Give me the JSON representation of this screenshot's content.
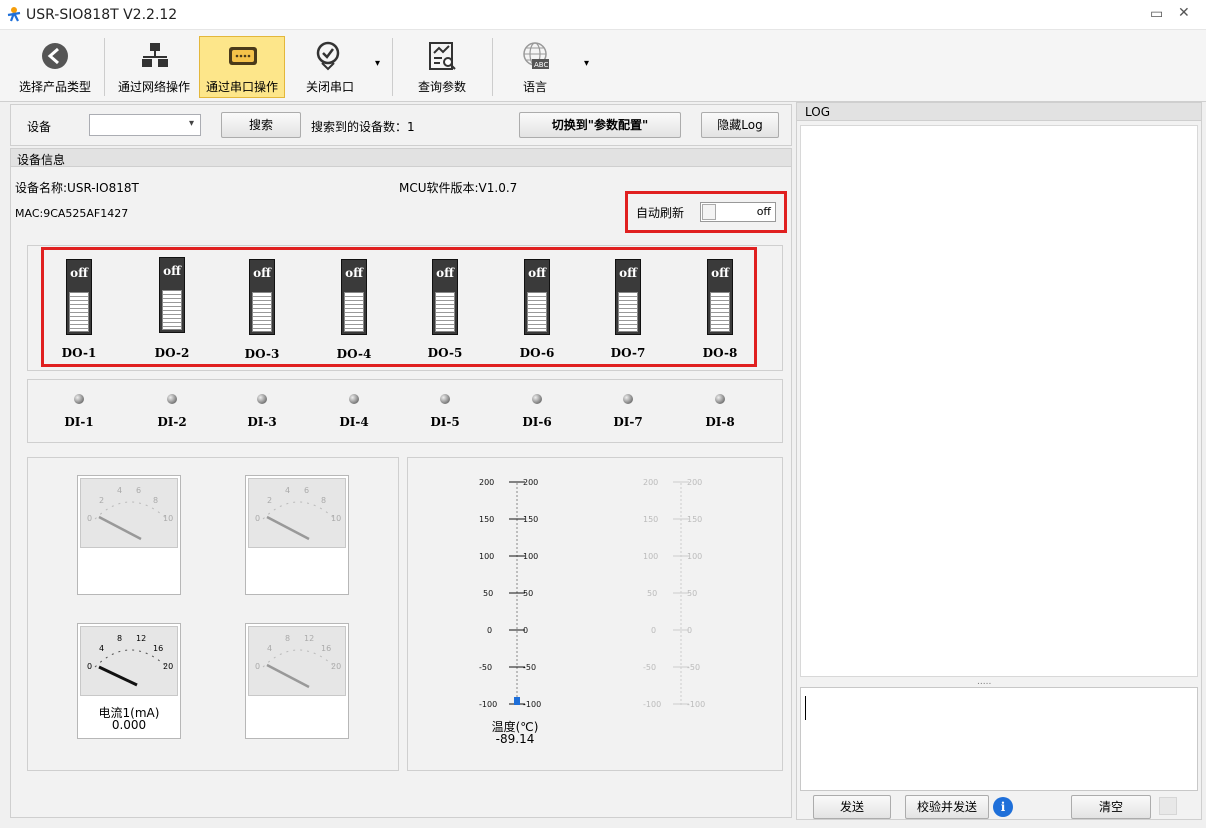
{
  "window": {
    "title": "USR-SIO818T V2.2.12"
  },
  "toolbar": {
    "items": [
      {
        "label": "选择产品类型",
        "icon": "back-arrow-icon"
      },
      {
        "label": "通过网络操作",
        "icon": "network-icon"
      },
      {
        "label": "通过串口操作",
        "icon": "serial-port-icon"
      },
      {
        "label": "关闭串口",
        "icon": "check-pin-icon"
      },
      {
        "label": "查询参数",
        "icon": "query-chart-icon"
      },
      {
        "label": "语言",
        "icon": "globe-abc-icon"
      }
    ]
  },
  "device_bar": {
    "device_label": "设备",
    "device_value": "",
    "search_label": "搜索",
    "found_label": "搜索到的设备数：1",
    "switch_config_label": "切换到\"参数配置\"",
    "hide_log_label": "隐藏Log"
  },
  "device_info": {
    "header": "设备信息",
    "name": "设备名称:USR-IO818T",
    "mcu": "MCU软件版本:V1.0.7",
    "mac": "MAC:9CA525AF1427",
    "auto_refresh_label": "自动刷新",
    "auto_refresh_state": "off"
  },
  "do_switches": [
    {
      "label": "DO-1",
      "state": "off"
    },
    {
      "label": "DO-2",
      "state": "off"
    },
    {
      "label": "DO-3",
      "state": "off"
    },
    {
      "label": "DO-4",
      "state": "off"
    },
    {
      "label": "DO-5",
      "state": "off"
    },
    {
      "label": "DO-6",
      "state": "off"
    },
    {
      "label": "DO-7",
      "state": "off"
    },
    {
      "label": "DO-8",
      "state": "off"
    }
  ],
  "di_inputs": [
    "DI-1",
    "DI-2",
    "DI-3",
    "DI-4",
    "DI-5",
    "DI-6",
    "DI-7",
    "DI-8"
  ],
  "gauges": [
    {
      "ticks": [
        "0",
        "2",
        "4",
        "6",
        "8",
        "10"
      ],
      "caption": "",
      "value": ""
    },
    {
      "ticks": [
        "0",
        "2",
        "4",
        "6",
        "8",
        "10"
      ],
      "caption": "",
      "value": ""
    },
    {
      "ticks": [
        "0",
        "4",
        "8",
        "12",
        "16",
        "20"
      ],
      "caption": "电流1(mA)",
      "value": "0.000"
    },
    {
      "ticks": [
        "0",
        "4",
        "8",
        "12",
        "16",
        "20"
      ],
      "caption": "",
      "value": ""
    }
  ],
  "thermometers": [
    {
      "ticks": [
        "200",
        "150",
        "100",
        "50",
        "0",
        "-50",
        "-100"
      ],
      "caption": "温度(℃)",
      "value": "-89.14"
    },
    {
      "ticks": [
        "200",
        "150",
        "100",
        "50",
        "0",
        "-50",
        "-100"
      ],
      "caption": "",
      "value": ""
    }
  ],
  "log": {
    "header": "LOG",
    "send_label": "发送",
    "verify_send_label": "校验并发送",
    "clear_label": "清空",
    "splitter": "....."
  },
  "colors": {
    "highlight": "#e02020",
    "active_tab": "#fde68a",
    "accent_blue": "#1e6fd9"
  }
}
